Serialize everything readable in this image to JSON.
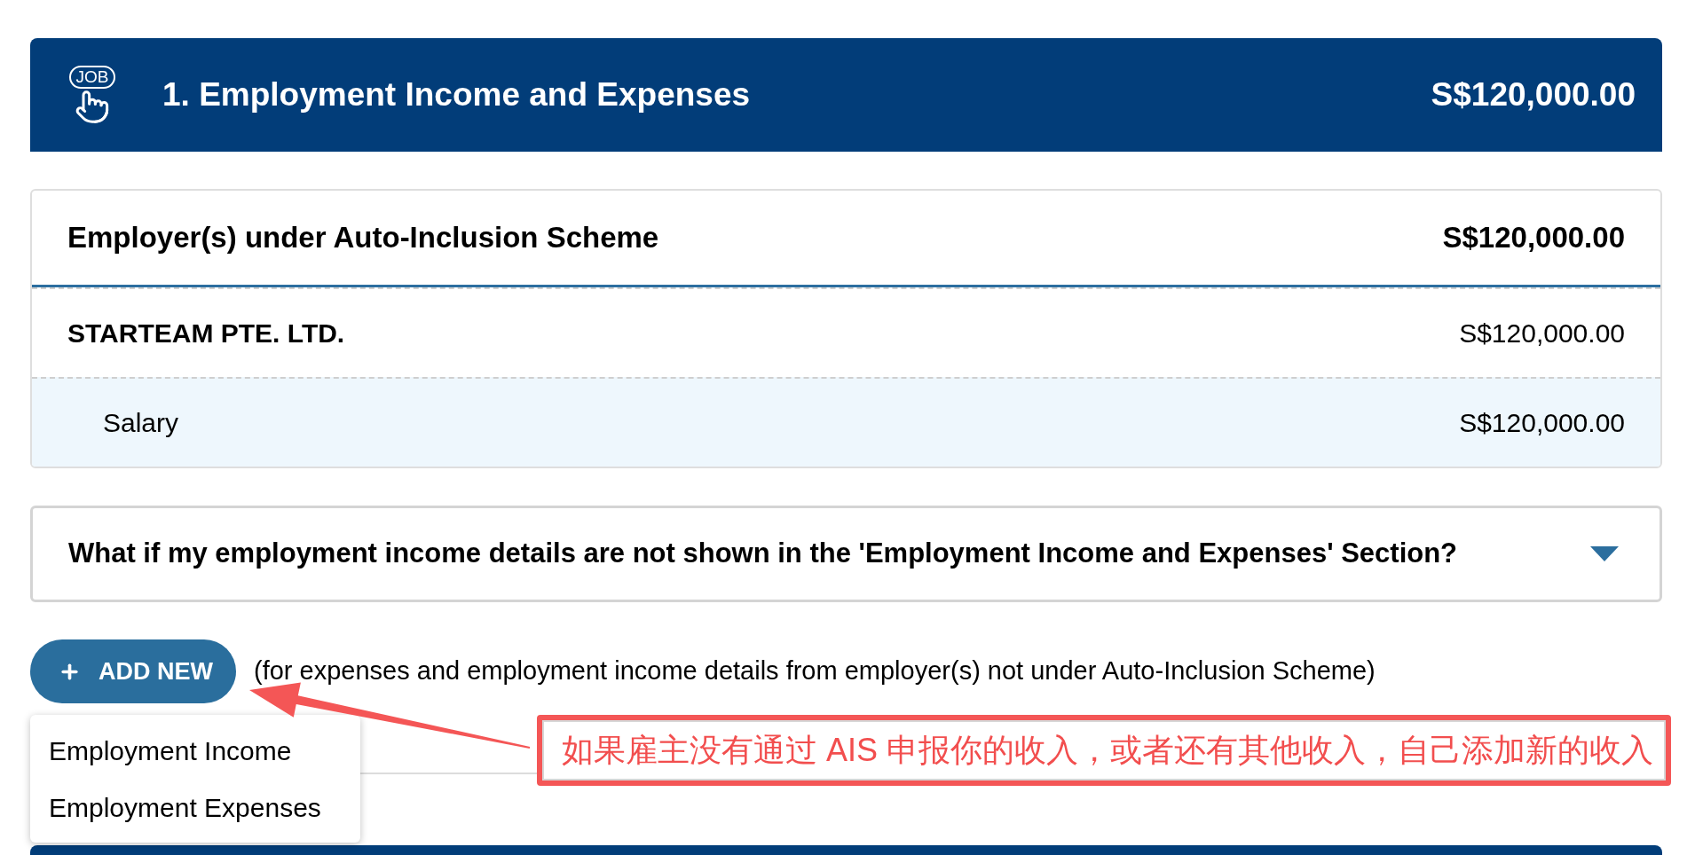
{
  "section": {
    "icon_label": "JOB",
    "title": "1. Employment Income and Expenses",
    "total": "S$120,000.00"
  },
  "employers_card": {
    "title": "Employer(s) under Auto-Inclusion Scheme",
    "total": "S$120,000.00",
    "rows": [
      {
        "kind": "employer",
        "label": "STARTEAM PTE. LTD.",
        "amount": "S$120,000.00"
      },
      {
        "kind": "item",
        "label": "Salary",
        "amount": "S$120,000.00"
      }
    ]
  },
  "faq": {
    "question": "What if my employment income details are not shown in the 'Employment Income and Expenses' Section?",
    "expanded": false
  },
  "add_new": {
    "label": "ADD NEW",
    "note": "(for expenses and employment income details from employer(s) not under Auto-Inclusion Scheme)",
    "menu": {
      "expanded": true,
      "items": [
        {
          "label": "Employment Income"
        },
        {
          "label": "Employment Expenses"
        }
      ]
    }
  },
  "annotation": {
    "text": "如果雇主没有通过 AIS 申报你的收入，或者还有其他收入，自己添加新的收入"
  }
}
